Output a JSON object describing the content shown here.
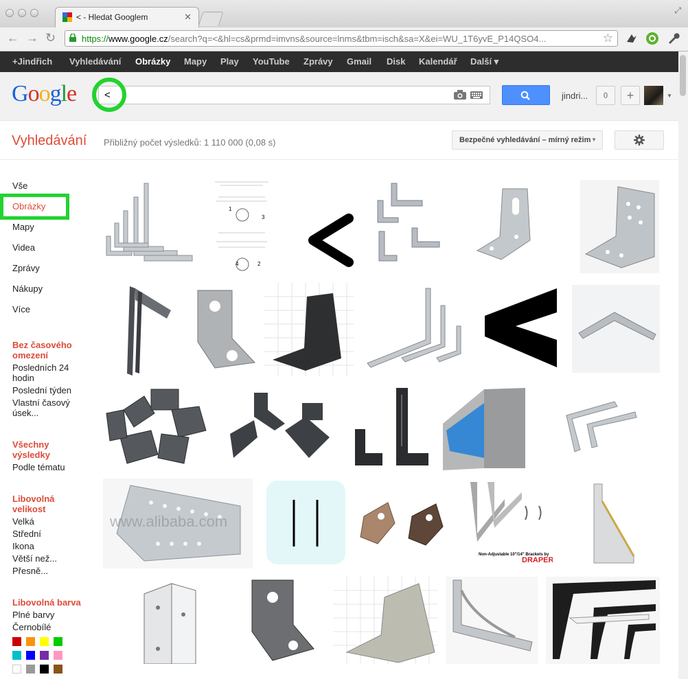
{
  "browser": {
    "tab_title": "< - Hledat Googlem",
    "url_scheme": "https://",
    "url_host": "www.google.cz",
    "url_rest": "/search?q=<&hl=cs&prmd=imvns&source=lnms&tbm=isch&sa=X&ei=WU_1T6yvE_P14QSO4..."
  },
  "gbar": {
    "items": [
      "+Jindřich",
      "Vyhledávání",
      "Obrázky",
      "Mapy",
      "Play",
      "YouTube",
      "Zprávy",
      "Gmail",
      "Disk",
      "Kalendář",
      "Další ▾"
    ],
    "active_index": 2
  },
  "header": {
    "logo": "Google",
    "query": "<",
    "user_name": "jindri...",
    "notifications": "0",
    "share": "+"
  },
  "results": {
    "title": "Vyhledávání",
    "stats": "Přibližný počet výsledků: 1 110 000 (0,08 s)",
    "safe_search": "Bezpečné vyhledávání – mírný režim"
  },
  "leftnav": {
    "items": [
      "Vše",
      "Obrázky",
      "Mapy",
      "Videa",
      "Zprávy",
      "Nákupy",
      "Více"
    ],
    "active_index": 1
  },
  "filters": {
    "time_head": "Bez časového omezení",
    "time_opts": [
      "Posledních 24 hodin",
      "Poslední týden",
      "Vlastní časový úsek..."
    ],
    "results_head": "Všechny výsledky",
    "results_opts": [
      "Podle tématu"
    ],
    "size_head": "Libovolná velikost",
    "size_opts": [
      "Velká",
      "Střední",
      "Ikona",
      "Větší než...",
      "Přesně..."
    ],
    "color_head": "Libovolná barva",
    "color_opts": [
      "Plné barvy",
      "Černobílé"
    ],
    "swatches": [
      "#cc0000",
      "#fb940b",
      "#ffff00",
      "#00cc00",
      "#03c0c6",
      "#0000ff",
      "#762ca7",
      "#ff98bf",
      "#ffffff",
      "#999999",
      "#000000",
      "#885418"
    ]
  },
  "images": {
    "alibaba_watermark": "www.alibaba.com",
    "bracket_caption": "Non-Adjustable 10\"/14\" Brackets by",
    "bracket_brand": "DRAPER"
  }
}
